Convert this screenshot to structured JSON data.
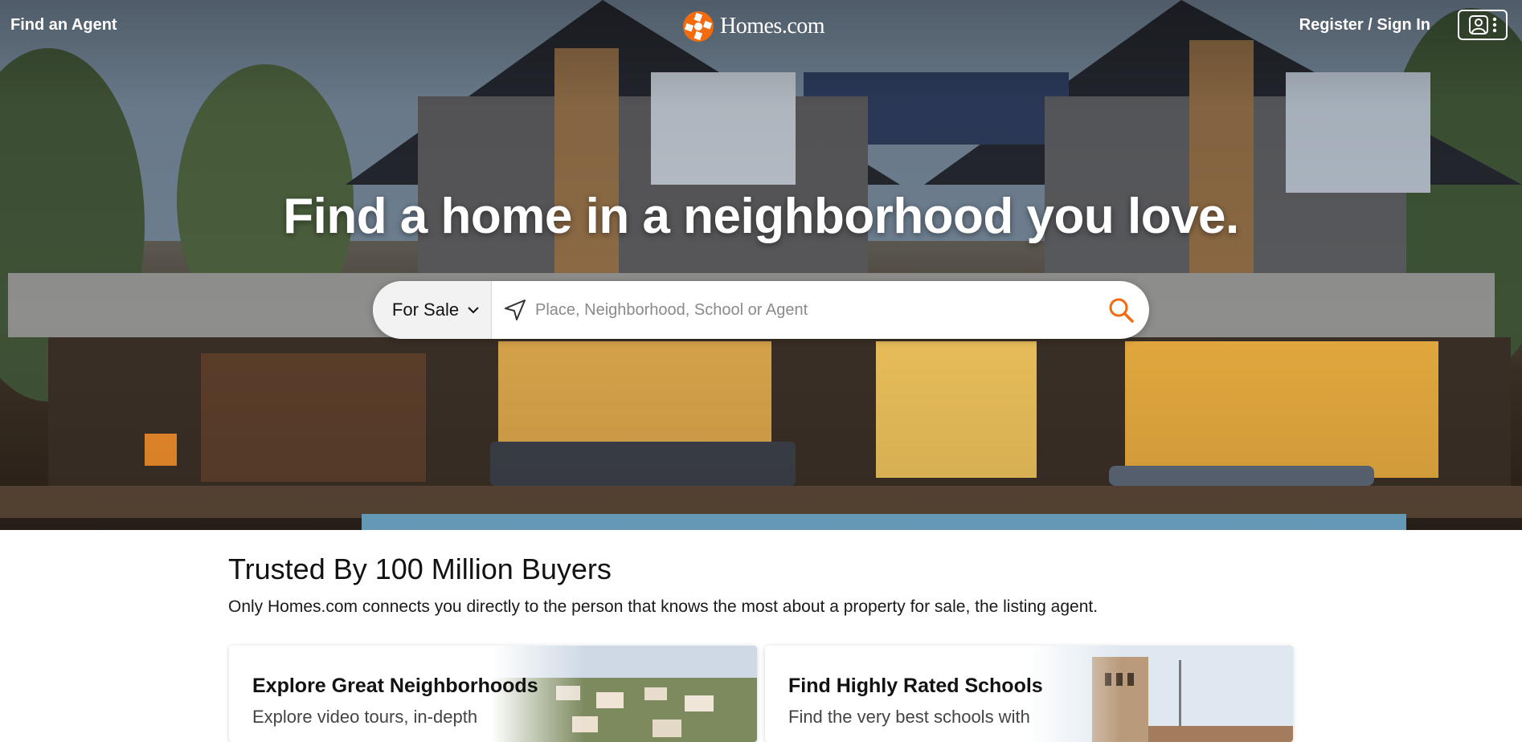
{
  "header": {
    "find_agent": "Find an Agent",
    "logo_text": "Homes.com",
    "register": "Register / Sign In"
  },
  "hero": {
    "headline": "Find a home in a neighborhood you love.",
    "search": {
      "type_selected": "For Sale",
      "placeholder": "Place, Neighborhood, School or Agent"
    }
  },
  "trusted": {
    "title": "Trusted By 100 Million Buyers",
    "subtitle": "Only Homes.com connects you directly to the person that knows the most about a property for sale, the listing agent."
  },
  "cards": [
    {
      "title": "Explore Great Neighborhoods",
      "desc": "Explore video tours, in-depth"
    },
    {
      "title": "Find Highly Rated Schools",
      "desc": "Find the very best schools with"
    }
  ],
  "colors": {
    "brand_orange": "#f26b0f",
    "text_dark": "#121212"
  },
  "icons": [
    "logo-icon",
    "account-icon",
    "kebab-icon",
    "chevron-down-icon",
    "location-arrow-icon",
    "search-icon"
  ]
}
